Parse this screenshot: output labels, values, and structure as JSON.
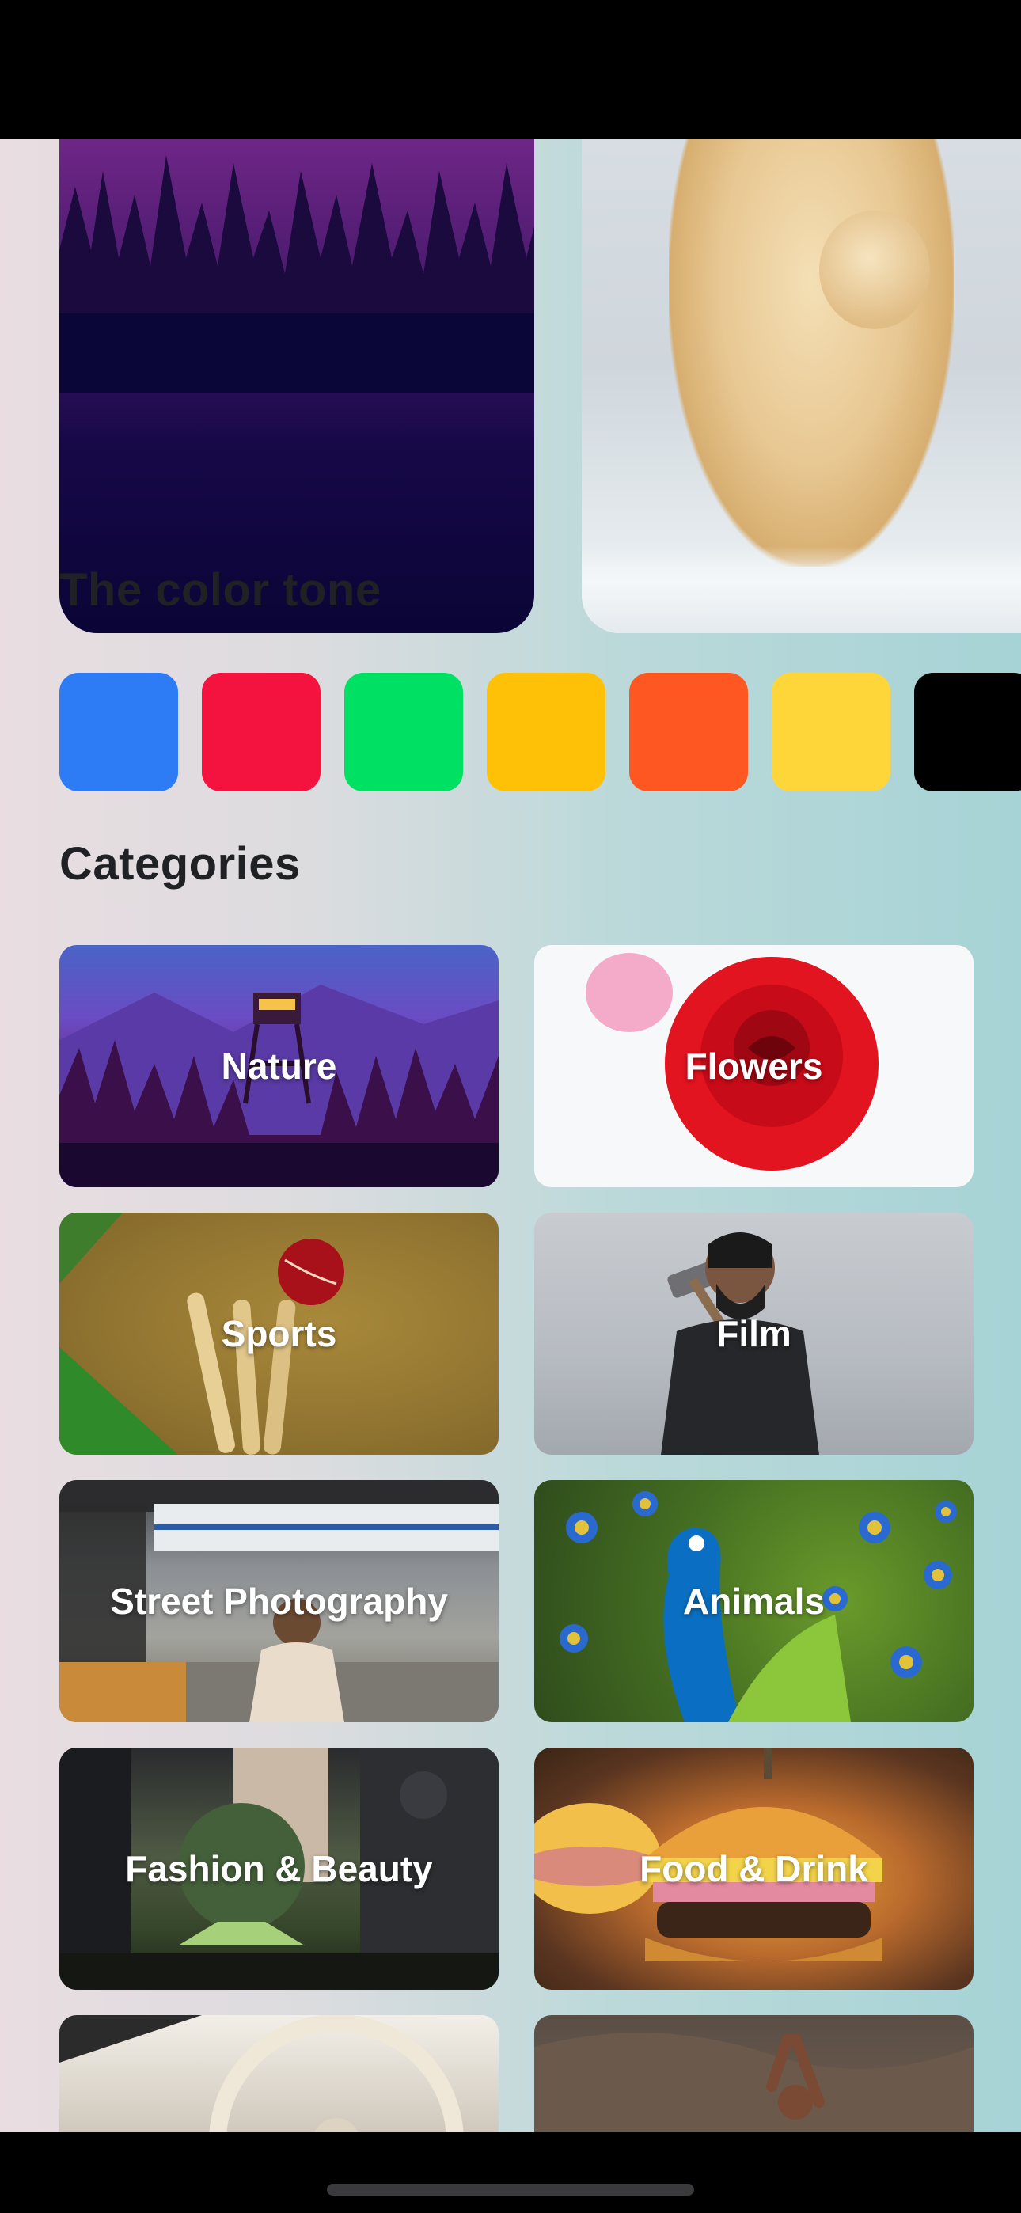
{
  "sections": {
    "color_tone_title": "The color tone",
    "categories_title": "Categories"
  },
  "color_tones": [
    {
      "name": "blue",
      "color": "#2d7cf6"
    },
    {
      "name": "red",
      "color": "#f4133f"
    },
    {
      "name": "green",
      "color": "#00e063"
    },
    {
      "name": "amber",
      "color": "#ffc107"
    },
    {
      "name": "orange",
      "color": "#ff5722"
    },
    {
      "name": "yellow",
      "color": "#ffd63a"
    },
    {
      "name": "black",
      "color": "#000000"
    }
  ],
  "categories": [
    {
      "label": "Nature"
    },
    {
      "label": "Flowers"
    },
    {
      "label": "Sports"
    },
    {
      "label": "Film"
    },
    {
      "label": "Street Photography"
    },
    {
      "label": "Animals"
    },
    {
      "label": "Fashion & Beauty"
    },
    {
      "label": "Food & Drink"
    },
    {
      "label": ""
    },
    {
      "label": ""
    }
  ]
}
